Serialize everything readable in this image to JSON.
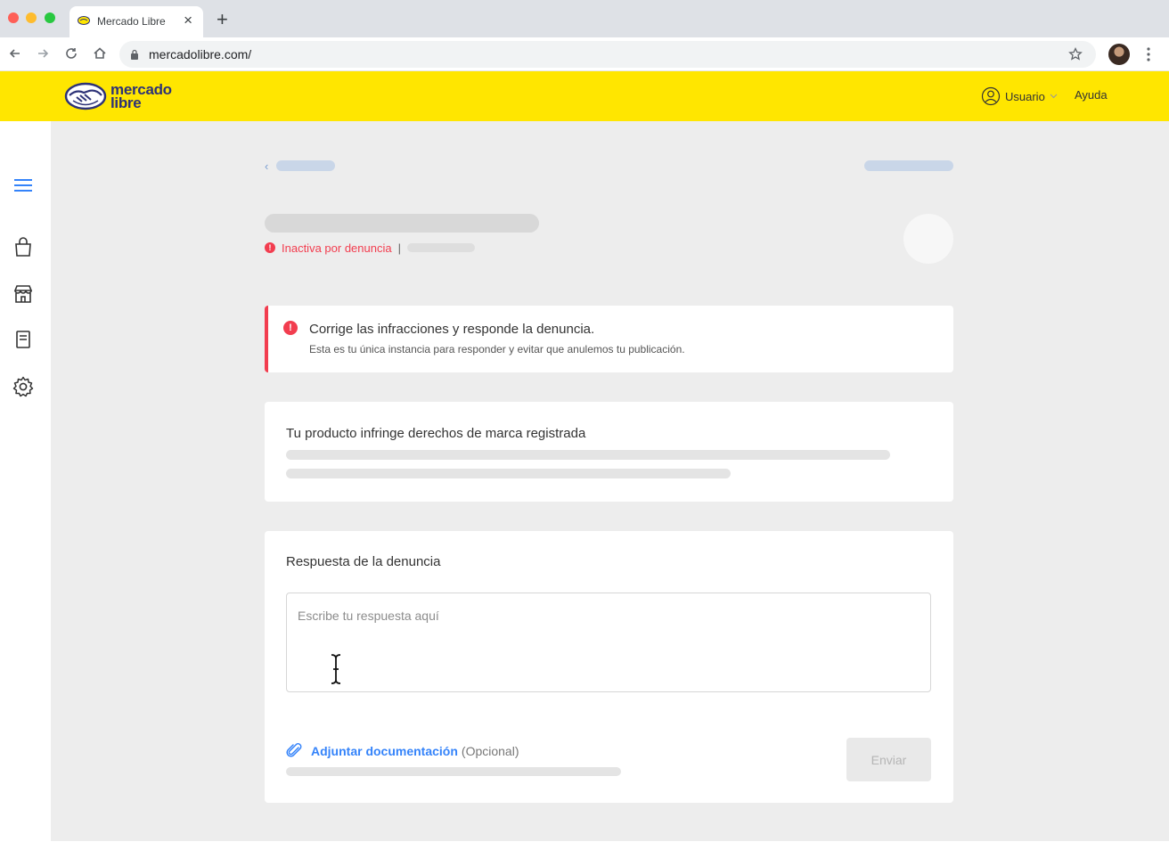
{
  "browser": {
    "tab_title": "Mercado Libre",
    "tab_close": "×",
    "new_tab": "+",
    "url": "mercadolibre.com/"
  },
  "header": {
    "logo_line1": "mercado",
    "logo_line2": "libre",
    "user_label": "Usuario",
    "help_label": "Ayuda",
    "brand_color": "#ffe600"
  },
  "sidebar": {
    "items": [
      {
        "icon": "menu-icon"
      },
      {
        "icon": "shopping-bag-icon"
      },
      {
        "icon": "store-icon"
      },
      {
        "icon": "document-icon"
      },
      {
        "icon": "gear-icon"
      }
    ]
  },
  "listing": {
    "back_chevron": "‹",
    "status_icon": "!",
    "status_text": "Inactiva por denuncia",
    "status_separator": "|"
  },
  "alert": {
    "icon": "!",
    "title": "Corrige las infracciones y responde la denuncia.",
    "description": "Esta es tu única instancia para responder y evitar que anulemos tu publicación.",
    "color": "#f23d4f"
  },
  "infraction": {
    "title": "Tu producto infringe derechos de marca registrada"
  },
  "response": {
    "title": "Respuesta de la denuncia",
    "placeholder": "Escribe tu respuesta aquí",
    "value": "",
    "attach_label": "Adjuntar documentación",
    "attach_optional": "(Opcional)",
    "send_label": "Enviar",
    "link_color": "#3483fa"
  }
}
